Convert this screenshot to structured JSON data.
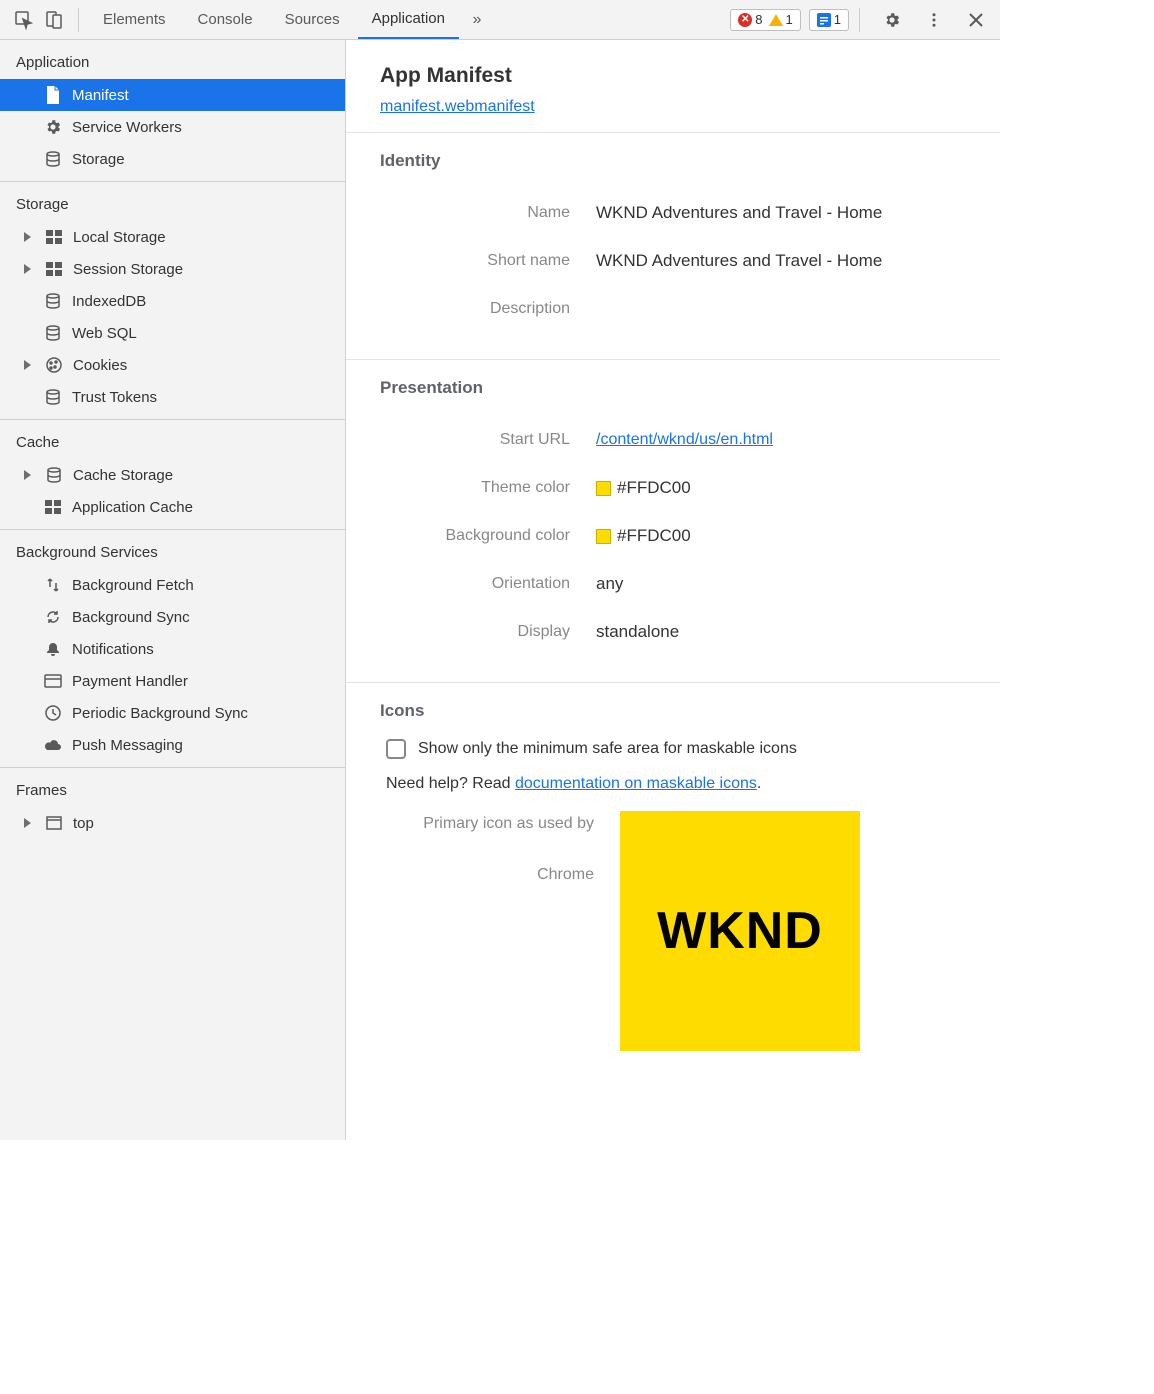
{
  "toolbar": {
    "tabs": [
      "Elements",
      "Console",
      "Sources",
      "Application"
    ],
    "active_tab": "Application",
    "errors": "8",
    "warnings": "1",
    "issues": "1"
  },
  "sidebar": {
    "sections": {
      "application": {
        "title": "Application",
        "items": [
          "Manifest",
          "Service Workers",
          "Storage"
        ]
      },
      "storage": {
        "title": "Storage",
        "items": [
          "Local Storage",
          "Session Storage",
          "IndexedDB",
          "Web SQL",
          "Cookies",
          "Trust Tokens"
        ]
      },
      "cache": {
        "title": "Cache",
        "items": [
          "Cache Storage",
          "Application Cache"
        ]
      },
      "bgservices": {
        "title": "Background Services",
        "items": [
          "Background Fetch",
          "Background Sync",
          "Notifications",
          "Payment Handler",
          "Periodic Background Sync",
          "Push Messaging"
        ]
      },
      "frames": {
        "title": "Frames",
        "items": [
          "top"
        ]
      }
    }
  },
  "manifest": {
    "title": "App Manifest",
    "file": "manifest.webmanifest",
    "identity": {
      "section": "Identity",
      "name_label": "Name",
      "name": "WKND Adventures and Travel - Home",
      "short_name_label": "Short name",
      "short_name": "WKND Adventures and Travel - Home",
      "description_label": "Description",
      "description": ""
    },
    "presentation": {
      "section": "Presentation",
      "start_url_label": "Start URL",
      "start_url": "/content/wknd/us/en.html",
      "theme_color_label": "Theme color",
      "theme_color": "#FFDC00",
      "background_color_label": "Background color",
      "background_color": "#FFDC00",
      "orientation_label": "Orientation",
      "orientation": "any",
      "display_label": "Display",
      "display": "standalone"
    },
    "icons": {
      "section": "Icons",
      "maskable_label": "Show only the minimum safe area for maskable icons",
      "help_prefix": "Need help? Read ",
      "help_link": "documentation on maskable icons",
      "help_suffix": ".",
      "primary_label_1": "Primary icon as used by",
      "primary_label_2": "Chrome",
      "icon_text": "WKND",
      "icon_bg": "#FFDC00"
    }
  }
}
